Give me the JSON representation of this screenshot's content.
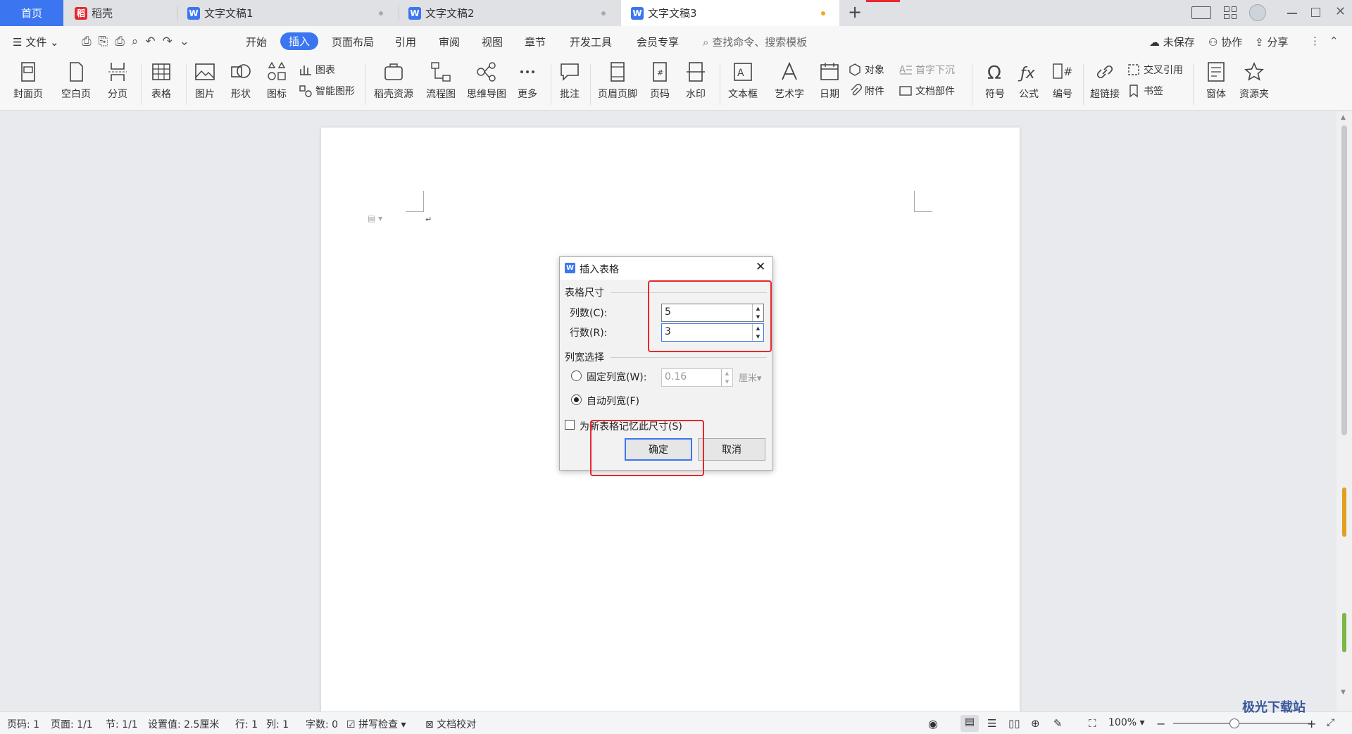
{
  "tabs": [
    {
      "label": "首页"
    },
    {
      "label": "稻壳"
    },
    {
      "label": "文字文稿1"
    },
    {
      "label": "文字文稿2"
    },
    {
      "label": "文字文稿3"
    }
  ],
  "new_tab": "+",
  "menu": {
    "file": "文件",
    "items": [
      "开始",
      "插入",
      "页面布局",
      "引用",
      "审阅",
      "视图",
      "章节",
      "开发工具",
      "会员专享"
    ],
    "search_placeholder": "查找命令、搜索模板",
    "unsaved": "未保存",
    "collab": "协作",
    "share": "分享"
  },
  "ribbon": {
    "big": [
      "封面页",
      "空白页",
      "分页",
      "表格",
      "图片",
      "形状",
      "图标",
      "稻壳资源",
      "流程图",
      "思维导图",
      "更多",
      "批注",
      "页眉页脚",
      "页码",
      "水印",
      "文本框",
      "艺术字",
      "日期",
      "符号",
      "公式",
      "编号",
      "超链接",
      "窗体",
      "资源夹"
    ],
    "small": {
      "chart": "图表",
      "smart": "智能图形",
      "object": "对象",
      "attach": "附件",
      "dropcap": "首字下沉",
      "docpart": "文档部件",
      "crossref": "交叉引用",
      "bookmark": "书签"
    }
  },
  "dialog": {
    "title": "插入表格",
    "size_group": "表格尺寸",
    "cols_label": "列数(C):",
    "cols_value": "5",
    "rows_label": "行数(R):",
    "rows_value": "3",
    "width_group": "列宽选择",
    "fixed_label": "固定列宽(W):",
    "fixed_value": "0.16",
    "unit": "厘米",
    "auto_label": "自动列宽(F)",
    "remember_label": "为新表格记忆此尺寸(S)",
    "ok": "确定",
    "cancel": "取消"
  },
  "status": {
    "page_no": "页码: 1",
    "pages": "页面: 1/1",
    "section": "节: 1/1",
    "setting": "设置值: 2.5厘米",
    "row": "行: 1",
    "col": "列: 1",
    "words": "字数: 0",
    "spell": "拼写检查",
    "proof": "文档校对",
    "zoom": "100%"
  },
  "watermark": "极光下载站",
  "colors": {
    "accent": "#3b76f0",
    "red_highlight": "#e8262b"
  }
}
